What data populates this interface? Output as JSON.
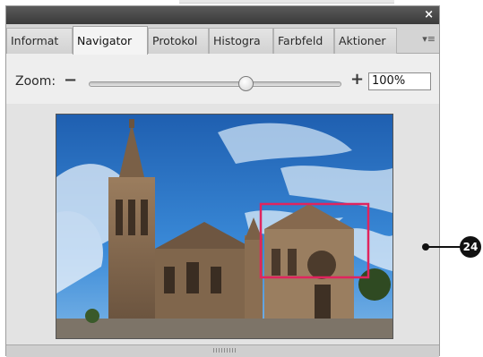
{
  "panel": {
    "close_glyph": "×",
    "menu_glyph": "▾≡",
    "tabs": [
      {
        "label": "Informat"
      },
      {
        "label": "Navigator"
      },
      {
        "label": "Protokol"
      },
      {
        "label": "Histogra"
      },
      {
        "label": "Farbfeld"
      },
      {
        "label": "Aktioner"
      }
    ],
    "active_tab": "Navigator"
  },
  "zoom": {
    "label": "Zoom:",
    "zoom_out_glyph": "−",
    "zoom_in_glyph": "+",
    "value": "100%",
    "slider_level": 0.62
  },
  "preview": {
    "image_subject": "church-photo",
    "view_rectangle_color": "#e0245e"
  },
  "callout": {
    "number": "24"
  },
  "colors": {
    "titlebar": "#4a4a4a",
    "panel_bg": "#e6e6e6",
    "sky": "#2f7fd0",
    "stone": "#8a6e52"
  }
}
